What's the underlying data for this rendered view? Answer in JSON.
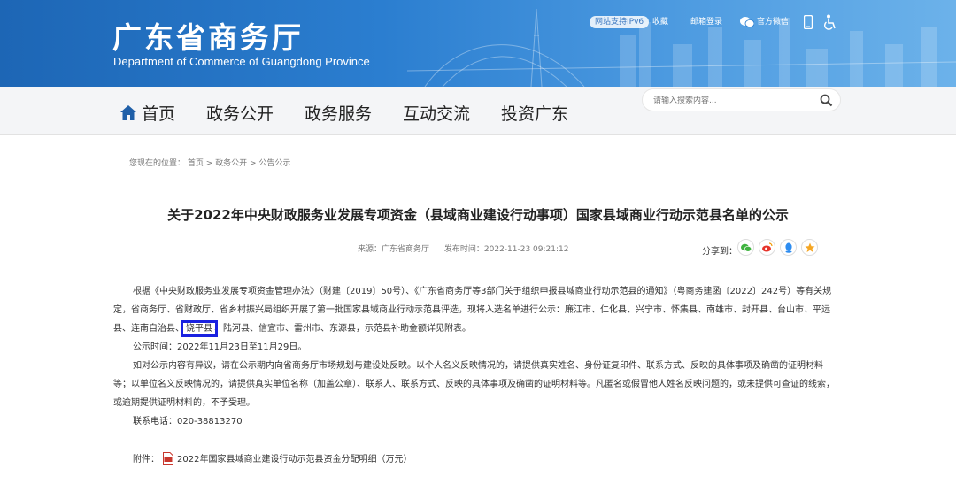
{
  "header": {
    "site_title": "广东省商务厅",
    "site_subtitle": "Department of Commerce of Guangdong Province",
    "ipv6_badge": "网站支持IPv6",
    "favorite_link": "收藏",
    "mail_link": "邮箱登录",
    "wechat_link": "官方微信",
    "icons": [
      "wechat-icon",
      "mobile-icon",
      "accessibility-icon"
    ]
  },
  "nav": {
    "items": [
      {
        "label": "首页"
      },
      {
        "label": "政务公开"
      },
      {
        "label": "政务服务"
      },
      {
        "label": "互动交流"
      },
      {
        "label": "投资广东"
      }
    ],
    "search_placeholder": "请输入搜索内容..."
  },
  "breadcrumb": "您现在的位置： 首页 > 政务公开 > 公告公示",
  "article": {
    "title": "关于2022年中央财政服务业发展专项资金（县域商业建设行动事项）国家县域商业行动示范县名单的公示",
    "source": "来源：广东省商务厅",
    "publish_time": "发布时间：2022-11-23 09:21:12",
    "share_label": "分享到：",
    "para1_before": "根据《中央财政服务业发展专项资金管理办法》（财建〔2019〕50号）、《广东省商务厅等3部门关于组织申报县域商业行动示范县的通知》（粤商务建函〔2022〕242号）等有关规定，省商务厅、省财政厅、省乡村振兴局组织开展了第一批国家县域商业行动示范县评选，现将入选名单进行公示：廉江市、仁化县、兴宁市、怀集县、南雄市、封开县、台山市、平远县、连南自治县、",
    "para1_highlight": "饶平县",
    "para1_after": "、陆河县、信宜市、雷州市、东源县，示范县补助金额详见附表。",
    "para2": "公示时间：2022年11月23日至11月29日。",
    "para3": "如对公示内容有异议，请在公示期内向省商务厅市场规划与建设处反映。以个人名义反映情况的，请提供真实姓名、身份证复印件、联系方式、反映的具体事项及确凿的证明材料等；以单位名义反映情况的，请提供真实单位名称（加盖公章）、联系人、联系方式、反映的具体事项及确凿的证明材料等。凡匿名或假冒他人姓名反映问题的，或未提供可查证的线索，或逾期提供证明材料的，不予受理。",
    "para4": "联系电话：020-38813270",
    "attachment_label": "附件：",
    "attachment_name": "2022年国家县域商业建设行动示范县资金分配明细（万元）"
  }
}
